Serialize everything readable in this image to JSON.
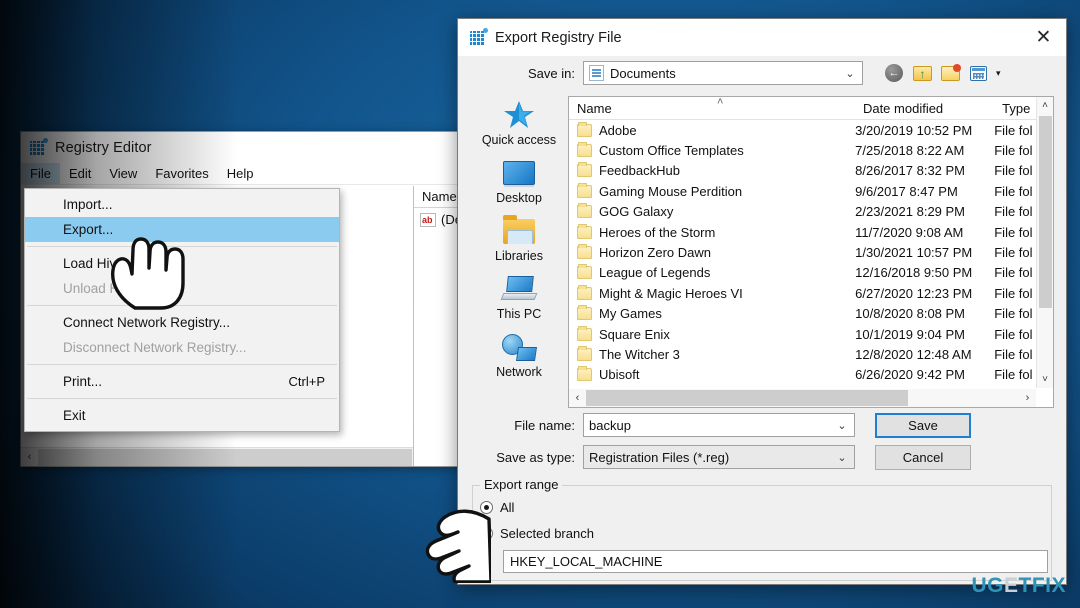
{
  "desktop": {
    "wallpaper_colors": [
      "#020d1c",
      "#0b3c68",
      "#1a6ba8"
    ]
  },
  "watermark": {
    "part1": "UG",
    "part2": "E",
    "part3": "TFIX",
    "full": "UGETFIX"
  },
  "regedit": {
    "title": "Registry Editor",
    "icon": "registry-icon",
    "menubar": [
      {
        "label": "File",
        "active": true
      },
      {
        "label": "Edit",
        "active": false
      },
      {
        "label": "View",
        "active": false
      },
      {
        "label": "Favorites",
        "active": false
      },
      {
        "label": "Help",
        "active": false
      }
    ],
    "values_pane": {
      "column_header": "Name",
      "rows": [
        {
          "icon": "string-value-icon",
          "name": "(Def"
        }
      ]
    },
    "scroll_left": "‹"
  },
  "file_menu": {
    "items": [
      {
        "label": "Import...",
        "accel": "",
        "state": "normal"
      },
      {
        "label": "Export...",
        "accel": "",
        "state": "selected"
      },
      {
        "separator": true
      },
      {
        "label": "Load Hive...",
        "accel": "",
        "state": "normal"
      },
      {
        "label": "Unload Hive...",
        "accel": "",
        "state": "disabled"
      },
      {
        "separator": true
      },
      {
        "label": "Connect Network Registry...",
        "accel": "",
        "state": "normal"
      },
      {
        "label": "Disconnect Network Registry...",
        "accel": "",
        "state": "disabled"
      },
      {
        "separator": true
      },
      {
        "label": "Print...",
        "accel": "Ctrl+P",
        "state": "normal"
      },
      {
        "separator": true
      },
      {
        "label": "Exit",
        "accel": "",
        "state": "normal"
      }
    ]
  },
  "dialog": {
    "title": "Export Registry File",
    "icon": "registry-icon",
    "close_label": "✕",
    "save_in": {
      "label": "Save in:",
      "value": "Documents",
      "chevron": "⌄"
    },
    "toolbar": [
      {
        "name": "back-button",
        "glyph": "←"
      },
      {
        "name": "up-one-level-button",
        "glyph": ""
      },
      {
        "name": "create-new-folder-button",
        "glyph": ""
      },
      {
        "name": "views-button",
        "glyph": ""
      },
      {
        "name": "views-dropdown-caret",
        "glyph": "▾"
      }
    ],
    "places": [
      {
        "label": "Quick access",
        "icon": "star-icon"
      },
      {
        "label": "Desktop",
        "icon": "desktop-icon"
      },
      {
        "label": "Libraries",
        "icon": "libraries-folder-icon"
      },
      {
        "label": "This PC",
        "icon": "computer-icon"
      },
      {
        "label": "Network",
        "icon": "network-icon"
      }
    ],
    "file_list": {
      "columns": [
        "Name",
        "Date modified",
        "Type"
      ],
      "sort_indicator": "˄",
      "rows": [
        {
          "name": "Adobe",
          "date": "3/20/2019 10:52 PM",
          "type": "File fol"
        },
        {
          "name": "Custom Office Templates",
          "date": "7/25/2018 8:22 AM",
          "type": "File fol"
        },
        {
          "name": "FeedbackHub",
          "date": "8/26/2017 8:32 PM",
          "type": "File fol"
        },
        {
          "name": "Gaming Mouse Perdition",
          "date": "9/6/2017 8:47 PM",
          "type": "File fol"
        },
        {
          "name": "GOG Galaxy",
          "date": "2/23/2021 8:29 PM",
          "type": "File fol"
        },
        {
          "name": "Heroes of the Storm",
          "date": "11/7/2020 9:08 AM",
          "type": "File fol"
        },
        {
          "name": "Horizon Zero Dawn",
          "date": "1/30/2021 10:57 PM",
          "type": "File fol"
        },
        {
          "name": "League of Legends",
          "date": "12/16/2018 9:50 PM",
          "type": "File fol"
        },
        {
          "name": "Might & Magic Heroes VI",
          "date": "6/27/2020 12:23 PM",
          "type": "File fol"
        },
        {
          "name": "My Games",
          "date": "10/8/2020 8:08 PM",
          "type": "File fol"
        },
        {
          "name": "Square Enix",
          "date": "10/1/2019 9:04 PM",
          "type": "File fol"
        },
        {
          "name": "The Witcher 3",
          "date": "12/8/2020 12:48 AM",
          "type": "File fol"
        },
        {
          "name": "Ubisoft",
          "date": "6/26/2020 9:42 PM",
          "type": "File fol"
        }
      ],
      "scroll_up": "˄",
      "scroll_down": "˅",
      "scroll_left": "‹",
      "scroll_right": "›"
    },
    "file_name": {
      "label": "File name:",
      "value": "backup",
      "chevron": "⌄"
    },
    "save_as_type": {
      "label": "Save as type:",
      "value": "Registration Files (*.reg)",
      "chevron": "⌄"
    },
    "buttons": {
      "save": "Save",
      "cancel": "Cancel"
    },
    "export_range": {
      "legend": "Export range",
      "options": [
        {
          "label": "All",
          "selected": true
        },
        {
          "label": "Selected branch",
          "selected": false
        }
      ],
      "branch_value": "HKEY_LOCAL_MACHINE"
    }
  }
}
